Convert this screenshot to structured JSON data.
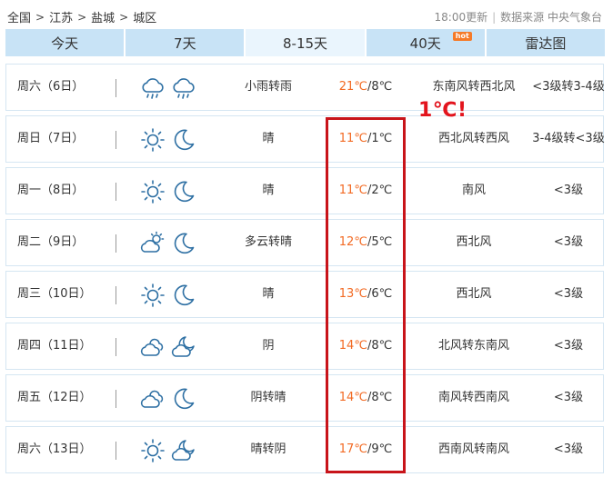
{
  "breadcrumb": [
    "全国",
    "江苏",
    "盐城",
    "城区"
  ],
  "breadcrumb_separator": ">",
  "update_time": "18:00更新",
  "source": "数据来源 中央气象台",
  "tabs": [
    {
      "label": "今天",
      "active": false,
      "badge": ""
    },
    {
      "label": "7天",
      "active": false,
      "badge": ""
    },
    {
      "label": "8-15天",
      "active": true,
      "badge": ""
    },
    {
      "label": "40天",
      "active": false,
      "badge": "hot"
    },
    {
      "label": "雷达图",
      "active": false,
      "badge": ""
    }
  ],
  "forecast": [
    {
      "day": "周六（6日）",
      "day_icon": "rain-cloud-icon",
      "night_icon": "rain-cloud-icon",
      "desc": "小雨转雨",
      "high": "21℃",
      "low": "/8℃",
      "wind": "东南风转西北风",
      "level": "<3级转3-4级"
    },
    {
      "day": "周日（7日）",
      "day_icon": "sun-icon",
      "night_icon": "moon-icon",
      "desc": "晴",
      "high": "11℃",
      "low": "/1℃",
      "wind": "西北风转西风",
      "level": "3-4级转<3级"
    },
    {
      "day": "周一（8日）",
      "day_icon": "sun-icon",
      "night_icon": "moon-icon",
      "desc": "晴",
      "high": "11℃",
      "low": "/2℃",
      "wind": "南风",
      "level": "<3级"
    },
    {
      "day": "周二（9日）",
      "day_icon": "partly-cloudy-icon",
      "night_icon": "moon-icon",
      "desc": "多云转晴",
      "high": "12℃",
      "low": "/5℃",
      "wind": "西北风",
      "level": "<3级"
    },
    {
      "day": "周三（10日）",
      "day_icon": "sun-icon",
      "night_icon": "moon-icon",
      "desc": "晴",
      "high": "13℃",
      "low": "/6℃",
      "wind": "西北风",
      "level": "<3级"
    },
    {
      "day": "周四（11日）",
      "day_icon": "overcast-icon",
      "night_icon": "cloudy-night-icon",
      "desc": "阴",
      "high": "14℃",
      "low": "/8℃",
      "wind": "北风转东南风",
      "level": "<3级"
    },
    {
      "day": "周五（12日）",
      "day_icon": "overcast-icon",
      "night_icon": "moon-icon",
      "desc": "阴转晴",
      "high": "14℃",
      "low": "/8℃",
      "wind": "南风转西南风",
      "level": "<3级"
    },
    {
      "day": "周六（13日）",
      "day_icon": "sun-icon",
      "night_icon": "cloudy-night-icon",
      "desc": "晴转阴",
      "high": "17℃",
      "low": "/9℃",
      "wind": "西南风转南风",
      "level": "<3级"
    }
  ],
  "annotation": {
    "text": "1℃!",
    "color": "#e3141d"
  },
  "colors": {
    "tab_bg": "#c8e3f6",
    "tab_active_bg": "#eaf5fd",
    "high_temp": "#f26a23",
    "icon_stroke": "#2d6fa3",
    "hot_badge": "#f57a28"
  }
}
